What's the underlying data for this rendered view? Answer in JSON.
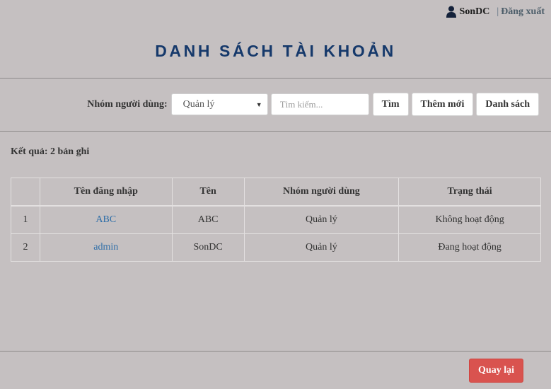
{
  "header": {
    "username": "SonDC",
    "separator": "|",
    "logout_label": "Đăng xuất",
    "user_icon": "user-icon"
  },
  "page_title": "DANH SÁCH TÀI KHOẢN",
  "filter": {
    "label": "Nhóm người dùng:",
    "selected_group": "Quản lý",
    "search_placeholder": "Tìm kiếm...",
    "search_button": "Tìm",
    "add_button": "Thêm mới",
    "list_button": "Danh sách"
  },
  "result_text": "Kết quả: 2 bản ghi",
  "table": {
    "columns": [
      "",
      "Tên đăng nhập",
      "Tên",
      "Nhóm người dùng",
      "Trạng thái"
    ],
    "rows": [
      {
        "index": "1",
        "username": "ABC",
        "name": "ABC",
        "group": "Quản lý",
        "status": "Không hoạt động"
      },
      {
        "index": "2",
        "username": "admin",
        "name": "SonDC",
        "group": "Quản lý",
        "status": "Đang hoạt động"
      }
    ]
  },
  "footer": {
    "back_button": "Quay lại"
  },
  "colors": {
    "background": "#c5c0c1",
    "title": "#16396b",
    "link": "#2f6ea8",
    "danger": "#d9534f"
  }
}
